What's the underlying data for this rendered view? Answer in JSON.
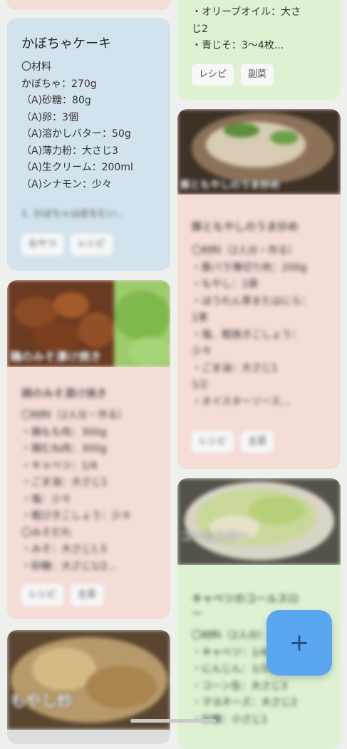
{
  "left_column": {
    "top_stub_color": "#f4dcd7",
    "card1": {
      "title": "かぼちゃケーキ",
      "lines": [
        "〇材料",
        "かぼちゃ：270g",
        "（A)砂糖：80g",
        "（A)卵：3個",
        "（A)溶かしバター：50g",
        "（A)薄力粉：大さじ3",
        "（A)生クリーム：200ml",
        "（A)シナモン：少々"
      ],
      "summary": "1. かぼちゃは皮をむい...",
      "tags": [
        "おやつ",
        "レシピ"
      ]
    },
    "card2": {
      "photo_caption": "鶏のみそ漬け焼き",
      "title": "鶏のみそ漬け焼き",
      "lines": [
        "〇材料（2人分・作る）",
        "・鶏もも肉：300g",
        "・鶏むね肉：300g",
        "・キャベツ：1/4",
        "・ごま油：大さじ1",
        "・塩：少々",
        "・粗びきこしょう：少々",
        "〇みそだれ",
        "・みそ：大さじ1.5",
        "・砂糖：大さじ1/2..."
      ],
      "tags": [
        "レシピ",
        "主菜"
      ]
    },
    "card3": {
      "photo_caption": "もやし炒"
    }
  },
  "right_column": {
    "card1": {
      "lines": [
        "・オリーブオイル：大さ",
        "じ2",
        "・青じそ：3〜4枚..."
      ],
      "tags": [
        "レシピ",
        "副菜"
      ]
    },
    "card2": {
      "photo_caption": "豚ともやしのうま炒め",
      "title": "豚ともやしのうま炒め",
      "lines": [
        "〇材料（2人分・作る）",
        "・豚バラ薄切り肉：200g",
        "・もやし：1袋",
        "・ほうれん草またはにら：",
        "  1束",
        "・塩、粗挽きこしょう：",
        "  少々",
        "・ごま油：大さじ1",
        "  1/2",
        "・オイスターソース..."
      ],
      "tags": [
        "レシピ",
        "主菜"
      ]
    },
    "card3": {
      "photo_caption": "コールスロー",
      "title": "キャベツのコールスロ",
      "title2": "ー",
      "lines": [
        "〇材料（2人分）",
        "・キャベツ：1/4",
        "・にんじん：1/3本",
        "・コーン缶：大さじ3",
        "・マヨネーズ：大さじ2",
        "・砂糖：小さじ1"
      ]
    }
  },
  "fab": {
    "label": "+"
  },
  "colors": {
    "blue_card": "#d3e3ee",
    "pink_card": "#f4dcd7",
    "green_card": "#def2d3",
    "fab": "#5aa6f0"
  }
}
